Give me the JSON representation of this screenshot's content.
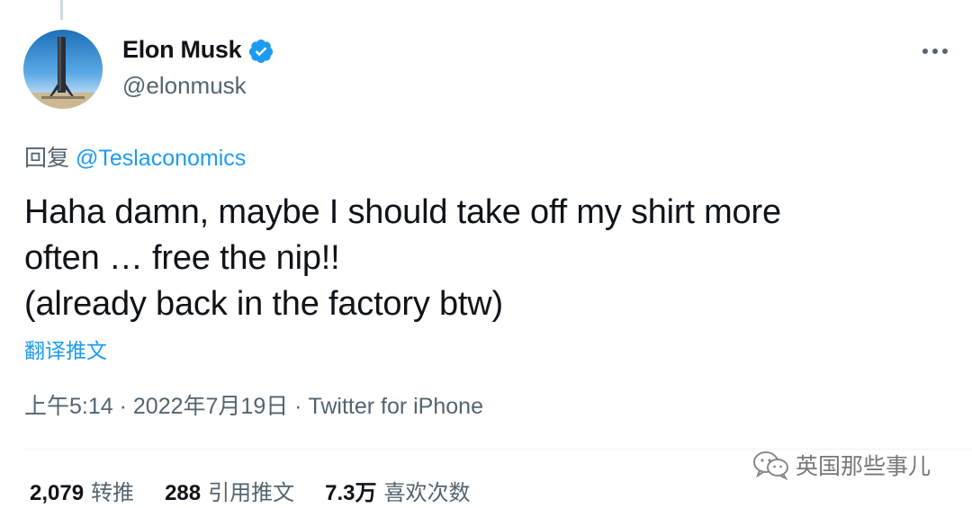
{
  "author": {
    "display_name": "Elon Musk",
    "handle": "@elonmusk",
    "verified": true
  },
  "reply_to": {
    "prefix": "回复",
    "mention": "@Teslaconomics"
  },
  "tweet": {
    "lines": [
      "Haha damn, maybe I should take off my shirt more",
      "often … free the nip!!",
      "(already back in the factory btw)"
    ]
  },
  "translate_label": "翻译推文",
  "meta": {
    "time": "上午5:14",
    "separator": " · ",
    "date": "2022年7月19日",
    "source": "Twitter for iPhone"
  },
  "stats": {
    "retweets": {
      "count": "2,079",
      "label": "转推"
    },
    "quotes": {
      "count": "288",
      "label": "引用推文"
    },
    "likes": {
      "count": "7.3万",
      "label": "喜欢次数"
    }
  },
  "watermark": {
    "text": "英国那些事儿"
  },
  "colors": {
    "accent": "#1d9bf0",
    "secondary_text": "#536471",
    "primary_text": "#0f1419"
  },
  "icons": {
    "verified": "verified-badge-icon",
    "more": "more-options-icon",
    "watermark_logo": "wechat-logo-icon"
  }
}
